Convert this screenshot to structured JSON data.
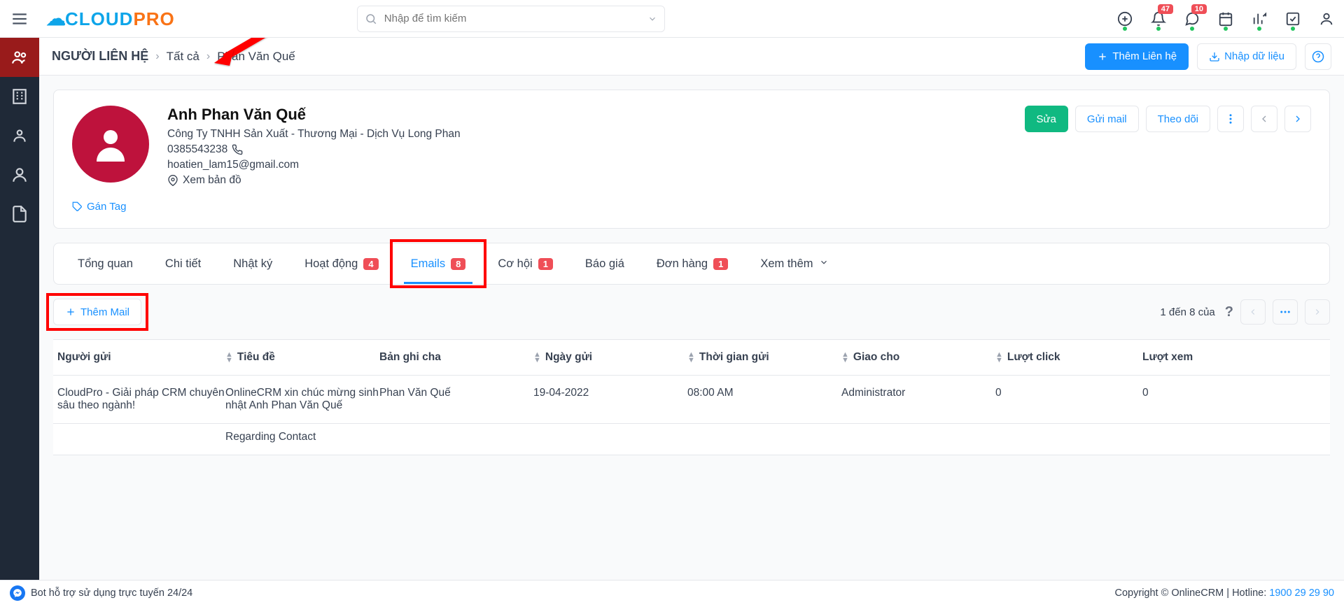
{
  "top": {
    "logo_cloud": "CLOUD",
    "logo_pro": "PRO",
    "search_placeholder": "Nhập để tìm kiếm",
    "bell_badge": "47",
    "chat_badge": "10"
  },
  "crumb": {
    "root": "NGƯỜI LIÊN HỆ",
    "all": "Tất cả",
    "name": "Phan Văn Quế",
    "addBtn": "Thêm Liên hệ",
    "importBtn": "Nhập dữ liệu"
  },
  "profile": {
    "title": "Anh Phan Văn Quế",
    "company": "Công Ty TNHH Sản Xuất - Thương Mại - Dịch Vụ Long Phan",
    "phone": "0385543238",
    "email": "hoatien_lam15@gmail.com",
    "map": "Xem bản đồ",
    "tag": "Gán Tag",
    "editBtn": "Sửa",
    "mailBtn": "Gửi mail",
    "followBtn": "Theo dõi"
  },
  "tabs": [
    {
      "label": "Tổng quan",
      "count": null,
      "active": false
    },
    {
      "label": "Chi tiết",
      "count": null,
      "active": false
    },
    {
      "label": "Nhật ký",
      "count": null,
      "active": false
    },
    {
      "label": "Hoạt động",
      "count": "4",
      "active": false
    },
    {
      "label": "Emails",
      "count": "8",
      "active": true,
      "highlight": true
    },
    {
      "label": "Cơ hội",
      "count": "1",
      "active": false
    },
    {
      "label": "Báo giá",
      "count": null,
      "active": false
    },
    {
      "label": "Đơn hàng",
      "count": "1",
      "active": false
    },
    {
      "label": "Xem thêm",
      "count": null,
      "active": false,
      "chevron": true
    }
  ],
  "mail": {
    "addBtn": "Thêm Mail",
    "pager": "1 đến 8 của",
    "columns": [
      "Người gửi",
      "Tiêu đề",
      "Bản ghi cha",
      "Ngày gửi",
      "Thời gian gửi",
      "Giao cho",
      "Lượt click",
      "Lượt xem"
    ],
    "rows": [
      {
        "sender": "CloudPro - Giải pháp CRM chuyên sâu theo ngành!",
        "subject": "OnlineCRM xin chúc mừng sinh nhật Anh Phan Văn Quế",
        "parent": "Phan Văn Quế",
        "date": "19-04-2022",
        "time": "08:00 AM",
        "assigned": "Administrator",
        "clicks": "0",
        "views": "0"
      }
    ],
    "row2_partial": "Regarding Contact"
  },
  "footer": {
    "bot": "Bot hỗ trợ sử dụng trực tuyến 24/24",
    "copy": "Copyright © OnlineCRM | Hotline: ",
    "hotline": "1900 29 29 90"
  }
}
